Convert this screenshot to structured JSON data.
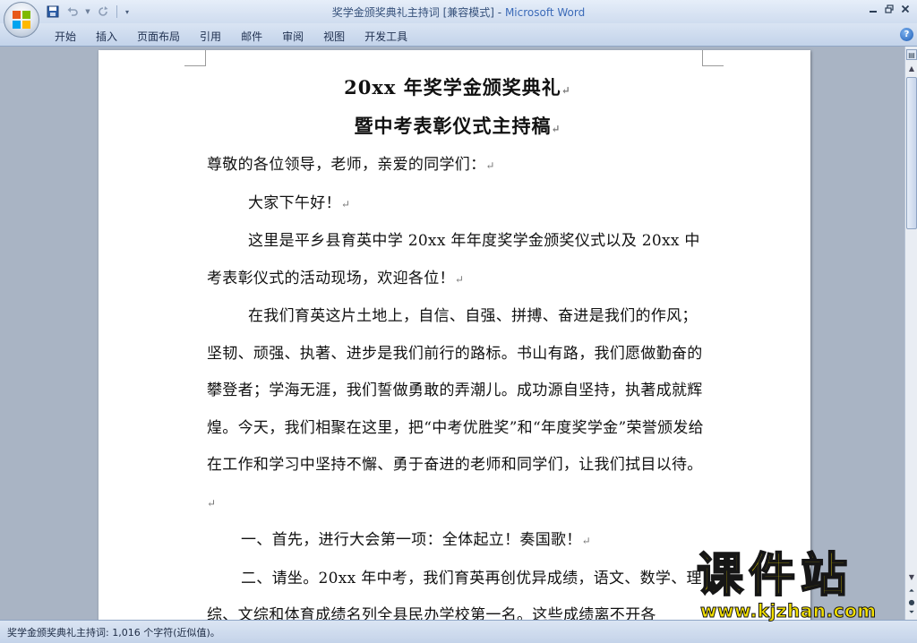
{
  "window": {
    "doc_name": "奖学金颁奖典礼主持词 [兼容模式]",
    "separator": " - ",
    "app_name": "Microsoft Word"
  },
  "ribbon": {
    "tabs": [
      "开始",
      "插入",
      "页面布局",
      "引用",
      "邮件",
      "审阅",
      "视图",
      "开发工具"
    ]
  },
  "document": {
    "title_line1": "20xx 年奖学金颁奖典礼",
    "title_line2": "暨中考表彰仪式主持稿",
    "p1": "尊敬的各位领导，老师，亲爱的同学们：",
    "p2": "大家下午好！",
    "p3": "这里是平乡县育英中学 20xx 年年度奖学金颁奖仪式以及 20xx 中考表彰仪式的活动现场，欢迎各位！",
    "p4": "在我们育英这片土地上，自信、自强、拼搏、奋进是我们的作风；坚韧、顽强、执著、进步是我们前行的路标。书山有路，我们愿做勤奋的攀登者；学海无涯，我们誓做勇敢的弄潮儿。成功源自坚持，执著成就辉煌。今天，我们相聚在这里，把“中考优胜奖”和“年度奖学金”荣誉颁发给在工作和学习中坚持不懈、勇于奋进的老师和同学们，让我们拭目以待。",
    "p5": "一、首先，进行大会第一项：全体起立！奏国歌！",
    "p6": "二、请坐。20xx 年中考，我们育英再创优异成绩，语文、数学、理综、文综和体育成绩名列全县民办学校第一名。这些成绩离不开各",
    "paragraph_mark": "↵"
  },
  "status": {
    "text": "奖学金颁奖典礼主持词: 1,016 个字符(近似值)。"
  },
  "watermark": {
    "big": "课件站",
    "url": "www.kjzhan.com"
  },
  "colors": {
    "app_name": "#3b6ab8",
    "watermark_fill": "#f4e000"
  }
}
